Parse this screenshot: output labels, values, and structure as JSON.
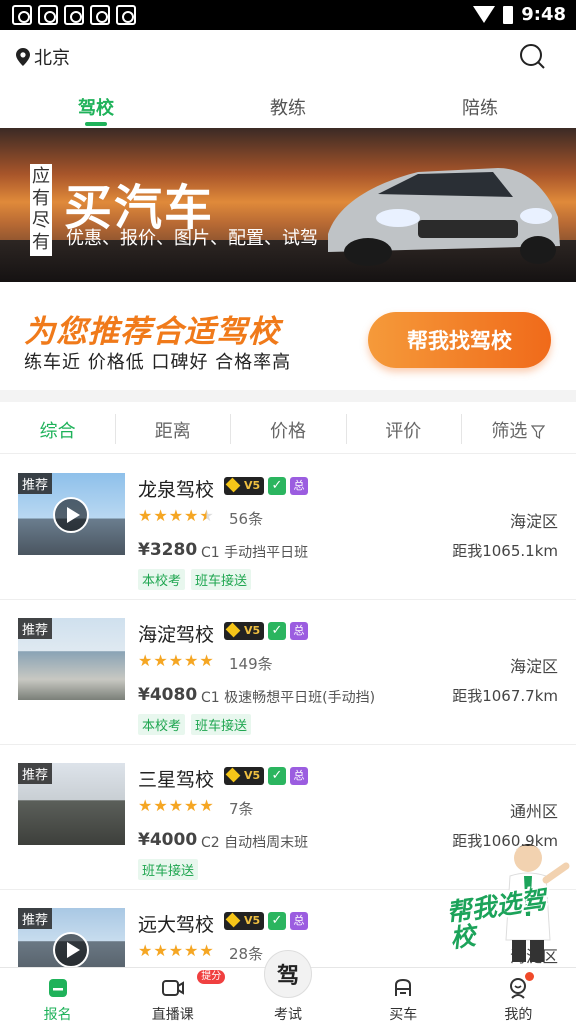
{
  "status_bar": {
    "time": "9:48",
    "notification_icons": [
      "app-icon",
      "app-icon",
      "app-icon",
      "app-icon",
      "app-icon"
    ]
  },
  "header": {
    "city": "北京",
    "search_icon": "search-icon"
  },
  "main_tabs": [
    {
      "label": "驾校",
      "active": true
    },
    {
      "label": "教练",
      "active": false
    },
    {
      "label": "陪练",
      "active": false
    }
  ],
  "ad_banner": {
    "vertical_text": "应有尽有",
    "title": "买汽车",
    "subtitle": "优惠、报价、图片、配置、试驾"
  },
  "recommend": {
    "title": "为您推荐合适驾校",
    "subtitle": "练车近  价格低  口碑好  合格率高",
    "button": "帮我找驾校"
  },
  "sort_tabs": [
    {
      "label": "综合",
      "active": true
    },
    {
      "label": "距离",
      "active": false
    },
    {
      "label": "价格",
      "active": false
    },
    {
      "label": "评价",
      "active": false
    },
    {
      "label": "筛选",
      "active": false
    }
  ],
  "schools": [
    {
      "tag": "推荐",
      "has_video": true,
      "name": "龙泉驾校",
      "rating": 4.5,
      "reviews": "56条",
      "district": "海淀区",
      "price": "¥3280",
      "course": "C1 手动挡平日班",
      "distance": "距我1065.1km",
      "tags": [
        "本校考",
        "班车接送"
      ],
      "badge_vip": "V5",
      "badge_check": "✓",
      "badge_zong": "总"
    },
    {
      "tag": "推荐",
      "has_video": false,
      "name": "海淀驾校",
      "rating": 5,
      "reviews": "149条",
      "district": "海淀区",
      "price": "¥4080",
      "course": "C1 极速畅想平日班(手动挡)",
      "distance": "距我1067.7km",
      "tags": [
        "本校考",
        "班车接送"
      ],
      "badge_vip": "V5",
      "badge_check": "✓",
      "badge_zong": "总"
    },
    {
      "tag": "推荐",
      "has_video": false,
      "name": "三星驾校",
      "rating": 5,
      "reviews": "7条",
      "district": "通州区",
      "price": "¥4000",
      "course": "C2 自动档周末班",
      "distance": "距我1060.9km",
      "tags": [
        "班车接送"
      ],
      "badge_vip": "V5",
      "badge_check": "✓",
      "badge_zong": "总"
    },
    {
      "tag": "推荐",
      "has_video": true,
      "name": "远大驾校",
      "rating": 5,
      "reviews": "28条",
      "district": "海淀区",
      "price": "",
      "course": "",
      "distance": "",
      "tags": [],
      "badge_vip": "V5",
      "badge_check": "✓",
      "badge_zong": "总"
    }
  ],
  "floating_helper": {
    "text": "帮我选驾校"
  },
  "bottom_nav": [
    {
      "label": "报名",
      "icon": "signup-icon",
      "active": true
    },
    {
      "label": "直播课",
      "icon": "live-icon",
      "active": false,
      "badge": "提分"
    },
    {
      "label": "考试",
      "icon": "exam-icon",
      "active": false,
      "center_glyph": "驾"
    },
    {
      "label": "买车",
      "icon": "car-icon",
      "active": false
    },
    {
      "label": "我的",
      "icon": "profile-icon",
      "active": false,
      "dot": true
    }
  ],
  "colors": {
    "accent": "#1fb25a",
    "orange": "#f07a1a",
    "star": "#f5a623"
  }
}
